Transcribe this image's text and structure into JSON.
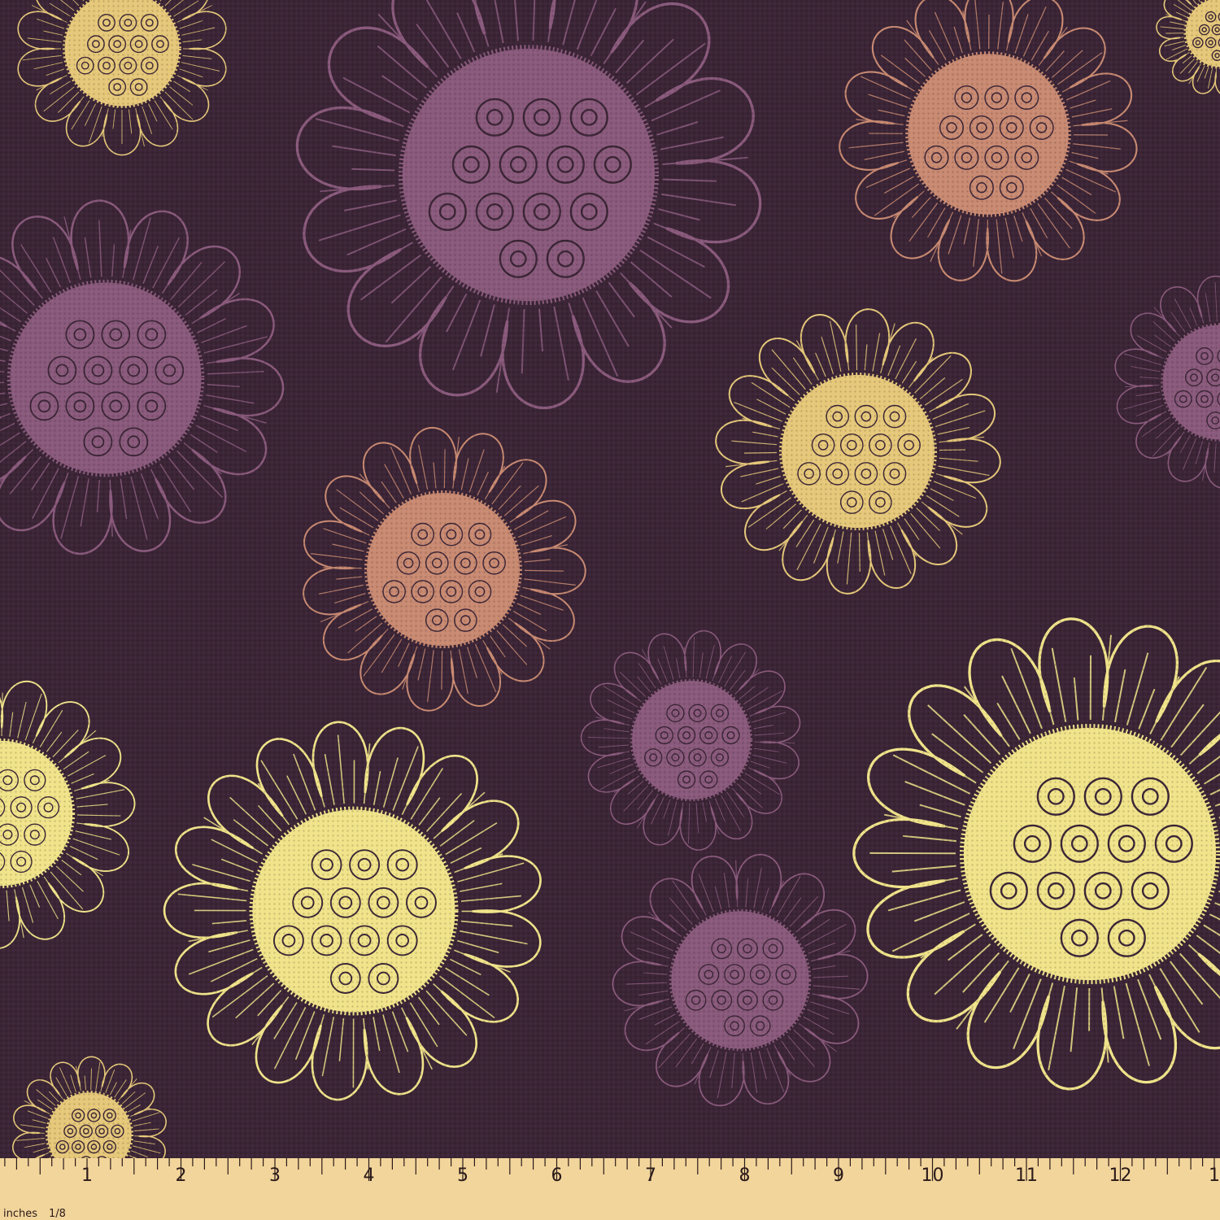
{
  "ruler": {
    "unit_label": "inches",
    "fraction_label": "1/8",
    "numbers": [
      "1",
      "2",
      "3",
      "4",
      "5",
      "6",
      "7",
      "8",
      "9",
      "10",
      "11",
      "12",
      "1"
    ],
    "colors": {
      "tape": "#f2d59b",
      "ink": "#2a1a1a"
    }
  },
  "fabric": {
    "background": "#3b2536",
    "flower_colors": {
      "yellow": "#f0e38a",
      "gold": "#e6c87a",
      "mauve": "#8a5a7c",
      "coral": "#c98a72"
    },
    "flowers": [
      {
        "color": "gold",
        "petals": 14
      },
      {
        "color": "mauve",
        "petals": 14
      },
      {
        "color": "coral",
        "petals": 15
      },
      {
        "color": "mauve",
        "petals": 15
      },
      {
        "color": "coral",
        "petals": 15
      },
      {
        "color": "gold",
        "petals": 16
      },
      {
        "color": "yellow",
        "petals": 15
      },
      {
        "color": "yellow",
        "petals": 17
      },
      {
        "color": "mauve",
        "petals": 15
      },
      {
        "color": "mauve",
        "petals": 14
      },
      {
        "color": "yellow",
        "petals": 17
      },
      {
        "color": "gold",
        "petals": 14
      },
      {
        "color": "mauve",
        "petals": 14
      },
      {
        "color": "gold",
        "petals": 14
      }
    ]
  }
}
